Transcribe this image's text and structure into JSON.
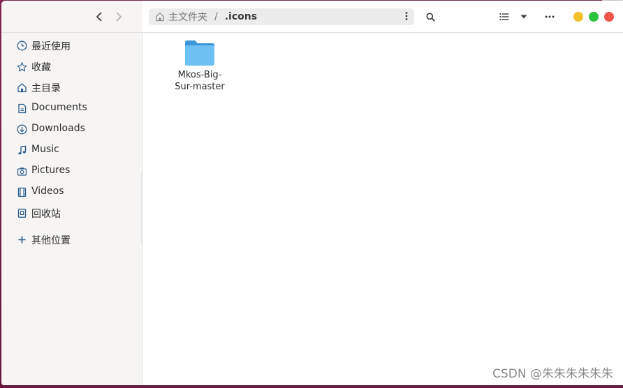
{
  "window": {
    "nav_back_icon": "chevron-left-icon",
    "nav_forward_icon": "chevron-right-icon"
  },
  "pathbar": {
    "home_label": "主文件夹",
    "separator": "/",
    "current": ".icons",
    "menu_icon": "vertical-dots-icon"
  },
  "toolbar": {
    "search_icon": "search-icon",
    "view_list_icon": "list-view-icon",
    "view_dropdown_icon": "chevron-down-icon",
    "more_icon": "horizontal-dots-icon"
  },
  "window_controls": {
    "minimize_color": "#f5c02b",
    "maximize_color": "#2ec33f",
    "close_color": "#f0544b"
  },
  "sidebar": {
    "items": [
      {
        "label": "最近使用",
        "icon": "clock-icon"
      },
      {
        "label": "收藏",
        "icon": "star-icon"
      },
      {
        "label": "主目录",
        "icon": "home-icon"
      },
      {
        "label": "Documents",
        "icon": "document-icon"
      },
      {
        "label": "Downloads",
        "icon": "download-icon"
      },
      {
        "label": "Music",
        "icon": "music-icon"
      },
      {
        "label": "Pictures",
        "icon": "camera-icon"
      },
      {
        "label": "Videos",
        "icon": "film-icon"
      },
      {
        "label": "回收站",
        "icon": "trash-icon"
      },
      {
        "label": "其他位置",
        "icon": "plus-icon"
      }
    ]
  },
  "files": [
    {
      "name": "Mkos-Big-\nSur-master",
      "icon": "folder-icon",
      "color": "#5bb2ea"
    }
  ],
  "watermark": "CSDN @朱朱朱朱朱朱"
}
